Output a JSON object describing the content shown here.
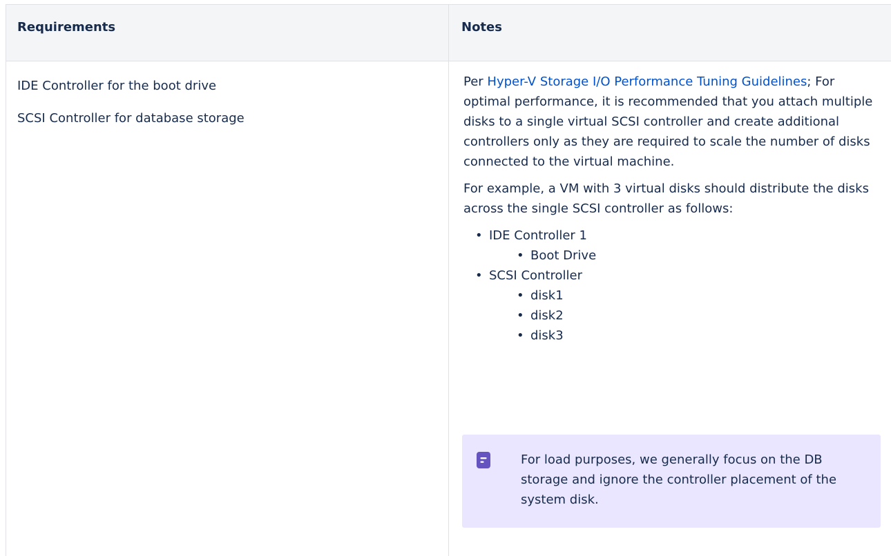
{
  "table": {
    "headers": [
      "Requirements",
      "Notes"
    ],
    "requirements": [
      "IDE Controller for the boot drive",
      "SCSI Controller for database storage"
    ],
    "notes": {
      "para1_prefix": "Per ",
      "para1_link": "Hyper-V Storage I/O Performance Tuning Guidelines",
      "para1_rest": "; For optimal performance, it is recommended that you attach multiple disks to a single virtual SCSI controller and create additional controllers only as they are required to scale the number of disks connected to the virtual machine.",
      "para2": "For example, a VM with 3 virtual disks should distribute the disks across the single SCSI controller as follows:",
      "list": [
        {
          "label": "IDE Controller 1",
          "children": [
            "Boot Drive"
          ]
        },
        {
          "label": "SCSI Controller",
          "children": [
            "disk1",
            "disk2",
            "disk3"
          ]
        }
      ]
    },
    "note_panel": {
      "icon": "note-icon",
      "text": "For load purposes, we generally focus on the DB storage and ignore the controller placement of the system disk.",
      "background": "#eae6ff",
      "icon_color": "#6554c0"
    },
    "link_color": "#0052cc"
  }
}
